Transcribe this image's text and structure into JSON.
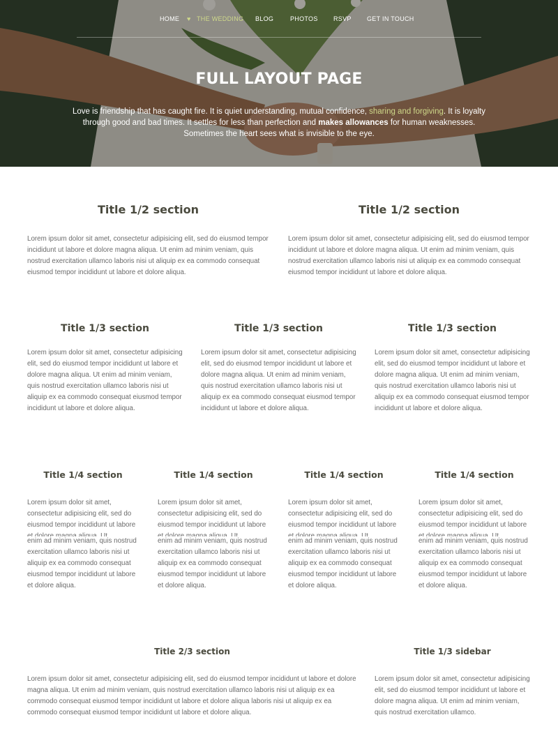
{
  "nav": {
    "items": [
      {
        "label": "HOME",
        "active": false
      },
      {
        "label": "THE WEDDING",
        "active": true
      },
      {
        "label": "BLOG",
        "active": false
      },
      {
        "label": "PHOTOS",
        "active": false
      },
      {
        "label": "RSVP",
        "active": false
      },
      {
        "label": "GET IN TOUCH",
        "active": false
      }
    ],
    "active_color": "#cfd98a"
  },
  "hero": {
    "title": "FULL LAYOUT PAGE",
    "text_part1": "Love is friendship that has caught fire. It is quiet understanding, mutual confidence, ",
    "text_highlight": "sharing and forgiving",
    "text_part2": ". It is loyalty through good and bad times. It settles for less than perfection and ",
    "text_bold": "makes allowances",
    "text_part3": " for human weaknesses. Sometimes the heart sees what is invisible to the eye."
  },
  "halves": {
    "title": "Title 1/2 section",
    "text": "Lorem ipsum dolor sit amet, consectetur adipisicing elit, sed do eiusmod tempor incididunt ut labore et dolore magna aliqua. Ut enim ad minim veniam, quis nostrud exercitation ullamco laboris nisi ut aliquip ex ea commodo consequat eiusmod tempor incididunt ut labore et dolore aliqua."
  },
  "thirds": {
    "title": "Title 1/3 section",
    "text": "Lorem ipsum dolor sit amet, consectetur adipisicing elit, sed do eiusmod tempor incididunt ut labore et dolore magna aliqua. Ut enim ad minim veniam, quis nostrud exercitation ullamco laboris nisi ut aliquip ex ea commodo consequat eiusmod tempor incididunt ut labore et dolore aliqua."
  },
  "quarters": {
    "title": "Title 1/4 section",
    "text_top": "Lorem ipsum dolor sit amet, consectetur adipisicing elit, sed do eiusmod tempor incididunt ut labore et dolore magna aliqua. Ut",
    "text_bottom": "enim ad minim veniam, quis nostrud exercitation ullamco laboris nisi ut aliquip ex ea commodo consequat eiusmod tempor incididunt ut labore et dolore aliqua."
  },
  "two_thirds": {
    "title": "Title 2/3 section",
    "text": "Lorem ipsum dolor sit amet, consectetur adipisicing elit, sed do eiusmod tempor incididunt ut labore et dolore magna aliqua. Ut enim ad minim veniam, quis nostrud exercitation ullamco laboris nisi ut aliquip ex ea commodo consequat eiusmod tempor incididunt ut labore et dolore aliqua laboris nisi ut aliquip ex ea commodo consequat eiusmod tempor incididunt ut labore et dolore aliqua."
  },
  "sidebar": {
    "title": "Title 1/3 sidebar",
    "text": "Lorem ipsum dolor sit amet, consectetur adipisicing elit, sed do eiusmod tempor incididunt ut labore et dolore magna aliqua. Ut enim ad minim veniam, quis nostrud exercitation ullamco."
  }
}
